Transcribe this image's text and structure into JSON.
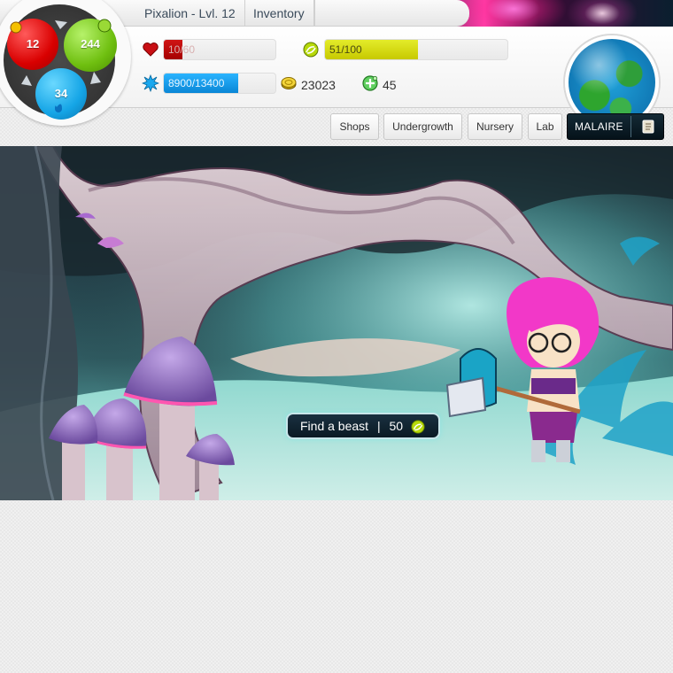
{
  "tabs": {
    "character": "Pixalion - Lvl. 12",
    "inventory": "Inventory"
  },
  "wheel": {
    "red_value": "12",
    "green_value": "244",
    "blue_value": "34"
  },
  "stats": {
    "health": {
      "text": "10/60",
      "fraction": 0.167
    },
    "energy": {
      "text": "51/100",
      "fraction": 0.51
    },
    "experience": {
      "text": "8900/13400",
      "fraction": 0.664
    },
    "coins": "23023",
    "gems": "45"
  },
  "nav": {
    "shops": "Shops",
    "undergrowth": "Undergrowth",
    "nursery": "Nursery",
    "lab": "Lab",
    "location": "MALAIRE"
  },
  "scene": {
    "find_beast_label": "Find a beast",
    "find_beast_separator": "|",
    "find_beast_cost": "50"
  },
  "icons": {
    "health": "heart-icon",
    "energy": "energy-icon",
    "experience": "star-burst-icon",
    "coins": "coin-icon",
    "gems": "gem-icon",
    "scroll": "scroll-icon",
    "globe": "globe-icon"
  },
  "colors": {
    "health": "#c40a0a",
    "energy": "#d4dd12",
    "experience": "#1aa3ef",
    "dark_button": "#0b1c26"
  }
}
